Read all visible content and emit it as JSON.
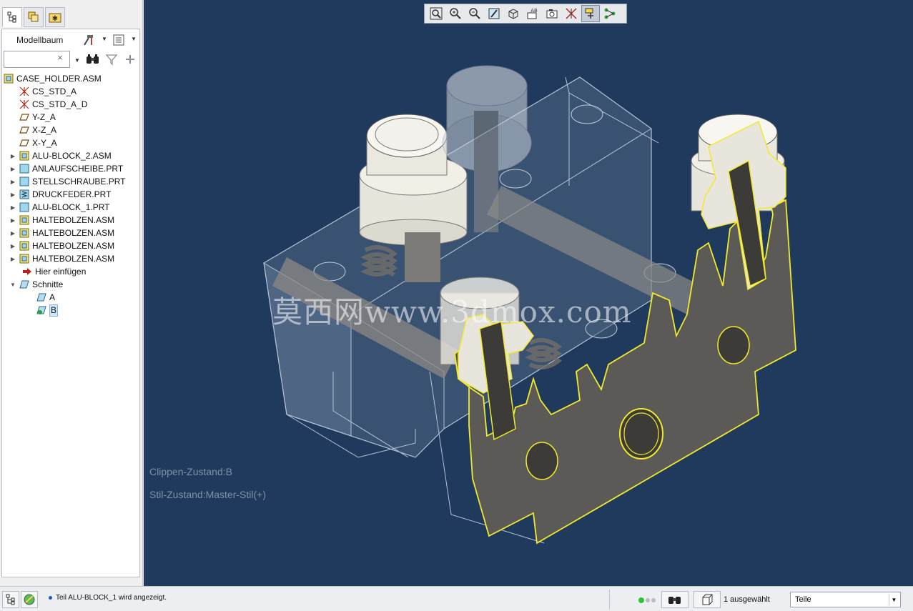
{
  "panel": {
    "tabs": [
      {
        "icon": "model-tree-icon",
        "active": true
      },
      {
        "icon": "layers-icon",
        "active": false
      },
      {
        "icon": "favorites-icon",
        "active": false
      }
    ],
    "tree_title": "Modellbaum",
    "search_placeholder": "",
    "search_clear": "×"
  },
  "tree": {
    "items": [
      {
        "label": "CASE_HOLDER.ASM",
        "icon": "assembly-icon",
        "indent": 0,
        "arrow": ""
      },
      {
        "label": "CS_STD_A",
        "icon": "coordinate-system-icon",
        "indent": 1,
        "arrow": ""
      },
      {
        "label": "CS_STD_A_D",
        "icon": "coordinate-system-icon",
        "indent": 1,
        "arrow": ""
      },
      {
        "label": "Y-Z_A",
        "icon": "datum-plane-icon",
        "indent": 1,
        "arrow": ""
      },
      {
        "label": "X-Z_A",
        "icon": "datum-plane-icon",
        "indent": 1,
        "arrow": ""
      },
      {
        "label": "X-Y_A",
        "icon": "datum-plane-icon",
        "indent": 1,
        "arrow": ""
      },
      {
        "label": "ALU-BLOCK_2.ASM",
        "icon": "assembly-icon",
        "indent": 1,
        "arrow": "▶"
      },
      {
        "label": "ANLAUFSCHEIBE.PRT",
        "icon": "part-icon",
        "indent": 1,
        "arrow": "▶"
      },
      {
        "label": "STELLSCHRAUBE.PRT",
        "icon": "part-icon",
        "indent": 1,
        "arrow": "▶"
      },
      {
        "label": "DRUCKFEDER.PRT",
        "icon": "spring-part-icon",
        "indent": 1,
        "arrow": "▶"
      },
      {
        "label": "ALU-BLOCK_1.PRT",
        "icon": "part-icon",
        "indent": 1,
        "arrow": "▶"
      },
      {
        "label": "HALTEBOLZEN.ASM",
        "icon": "assembly-icon",
        "indent": 1,
        "arrow": "▶"
      },
      {
        "label": "HALTEBOLZEN.ASM",
        "icon": "assembly-icon",
        "indent": 1,
        "arrow": "▶"
      },
      {
        "label": "HALTEBOLZEN.ASM",
        "icon": "assembly-icon",
        "indent": 1,
        "arrow": "▶"
      },
      {
        "label": "HALTEBOLZEN.ASM",
        "icon": "assembly-icon",
        "indent": 1,
        "arrow": "▶"
      },
      {
        "label": "Hier einfügen",
        "icon": "insert-here-icon",
        "indent": 1,
        "arrow": ""
      },
      {
        "label": "Schnitte",
        "icon": "sections-icon",
        "indent": 1,
        "arrow": "▼"
      },
      {
        "label": "A",
        "icon": "section-plane-icon",
        "indent": 2,
        "arrow": ""
      },
      {
        "label": "B",
        "icon": "section-plane-active-icon",
        "indent": 2,
        "arrow": "",
        "selected": true
      }
    ]
  },
  "viewport": {
    "toolbar": [
      {
        "icon": "refit-icon",
        "active": false
      },
      {
        "icon": "zoom-in-icon",
        "active": false
      },
      {
        "icon": "zoom-out-icon",
        "active": false
      },
      {
        "icon": "repaint-icon",
        "active": false
      },
      {
        "icon": "display-style-icon",
        "active": false
      },
      {
        "icon": "saved-orientations-icon",
        "active": false
      },
      {
        "icon": "view-manager-icon",
        "active": false
      },
      {
        "icon": "datum-display-icon",
        "active": false
      },
      {
        "icon": "spin-center-icon",
        "active": true
      },
      {
        "icon": "annotation-display-icon",
        "active": false
      }
    ],
    "clip_state": "Clippen-Zustand:B",
    "style_state": "Stil-Zustand:Master-Stil(+)",
    "watermark": "莫西网www.3dmox.com"
  },
  "status": {
    "message": "Teil ALU-BLOCK_1 wird angezeigt.",
    "selected": "1 ausgewählt",
    "filter_value": "Teile",
    "colors": {
      "green": "#2ec43a",
      "grey": "#b8bcc2"
    }
  }
}
